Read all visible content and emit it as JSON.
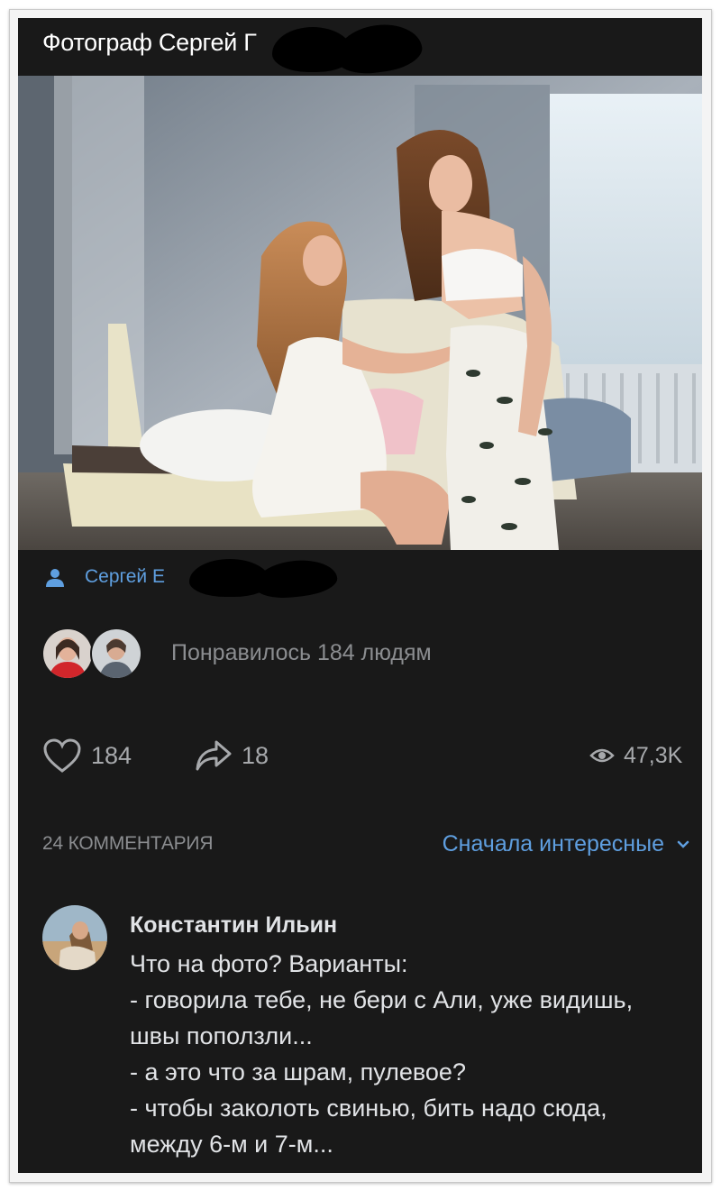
{
  "post": {
    "title": "Фотограф Сергей Г"
  },
  "author": {
    "name": "Сергей Е",
    "icon": "user-icon"
  },
  "likes": {
    "text": "Понравилось 184 людям"
  },
  "actions": {
    "like_count": "184",
    "share_count": "18",
    "views": "47,3K"
  },
  "comments": {
    "count_label": "24 КОММЕНТАРИЯ",
    "sort_label": "Сначала интересные",
    "items": [
      {
        "author": "Константин Ильин",
        "lines": [
          "Что на фото? Варианты:",
          "- говорила тебе, не бери с Али, уже видишь,",
          "швы поползли...",
          "- а это что за шрам, пулевое?",
          "- чтобы заколоть свинью, бить надо сюда,",
          "между 6-м и 7-м..."
        ]
      }
    ]
  },
  "colors": {
    "background": "#191919",
    "accent": "#5f9fe0",
    "text": "#e1e3e6",
    "muted": "#8b8d90"
  }
}
